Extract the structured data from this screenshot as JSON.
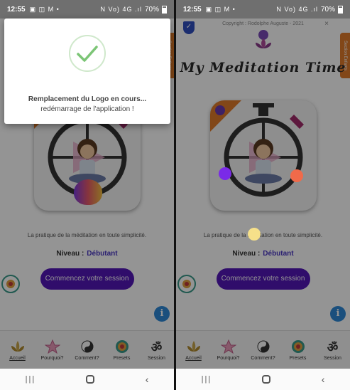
{
  "status_bar": {
    "time": "12:55",
    "notif_icons": "▣ ◫ M •",
    "signal_icons": "N Vo) 4G .ıl",
    "battery": "70%"
  },
  "screen": {
    "copyright": "Copyright : Rodolphe Auguste - 2021",
    "close_glyph": "×",
    "side_tab_label": "Section Enfants",
    "title": "My Meditation Time",
    "tagline": "La pratique de la méditation en toute simplicité.",
    "level_label": "Niveau :",
    "level_value": "Débutant",
    "start_button": "Commencez votre session",
    "info_glyph": "i"
  },
  "dialog": {
    "line1": "Remplacement du Logo en cours...",
    "line2": "redémarrage de l'application !"
  },
  "nav": [
    {
      "label": "Accueil",
      "icon": "lotus-gold-icon"
    },
    {
      "label": "Pourquoi?",
      "icon": "flower-pink-icon"
    },
    {
      "label": "Comment?",
      "icon": "yin-yang-icon"
    },
    {
      "label": "Presets",
      "icon": "mandala-icon"
    },
    {
      "label": "Session",
      "icon": "om-icon",
      "glyph": "ॐ"
    }
  ],
  "system_nav": {
    "back": "‹"
  },
  "colors": {
    "accent_purple": "#5418b8",
    "brand_orange": "#e07a2a",
    "info_blue": "#2d89d8",
    "check_green": "#7cc576"
  }
}
